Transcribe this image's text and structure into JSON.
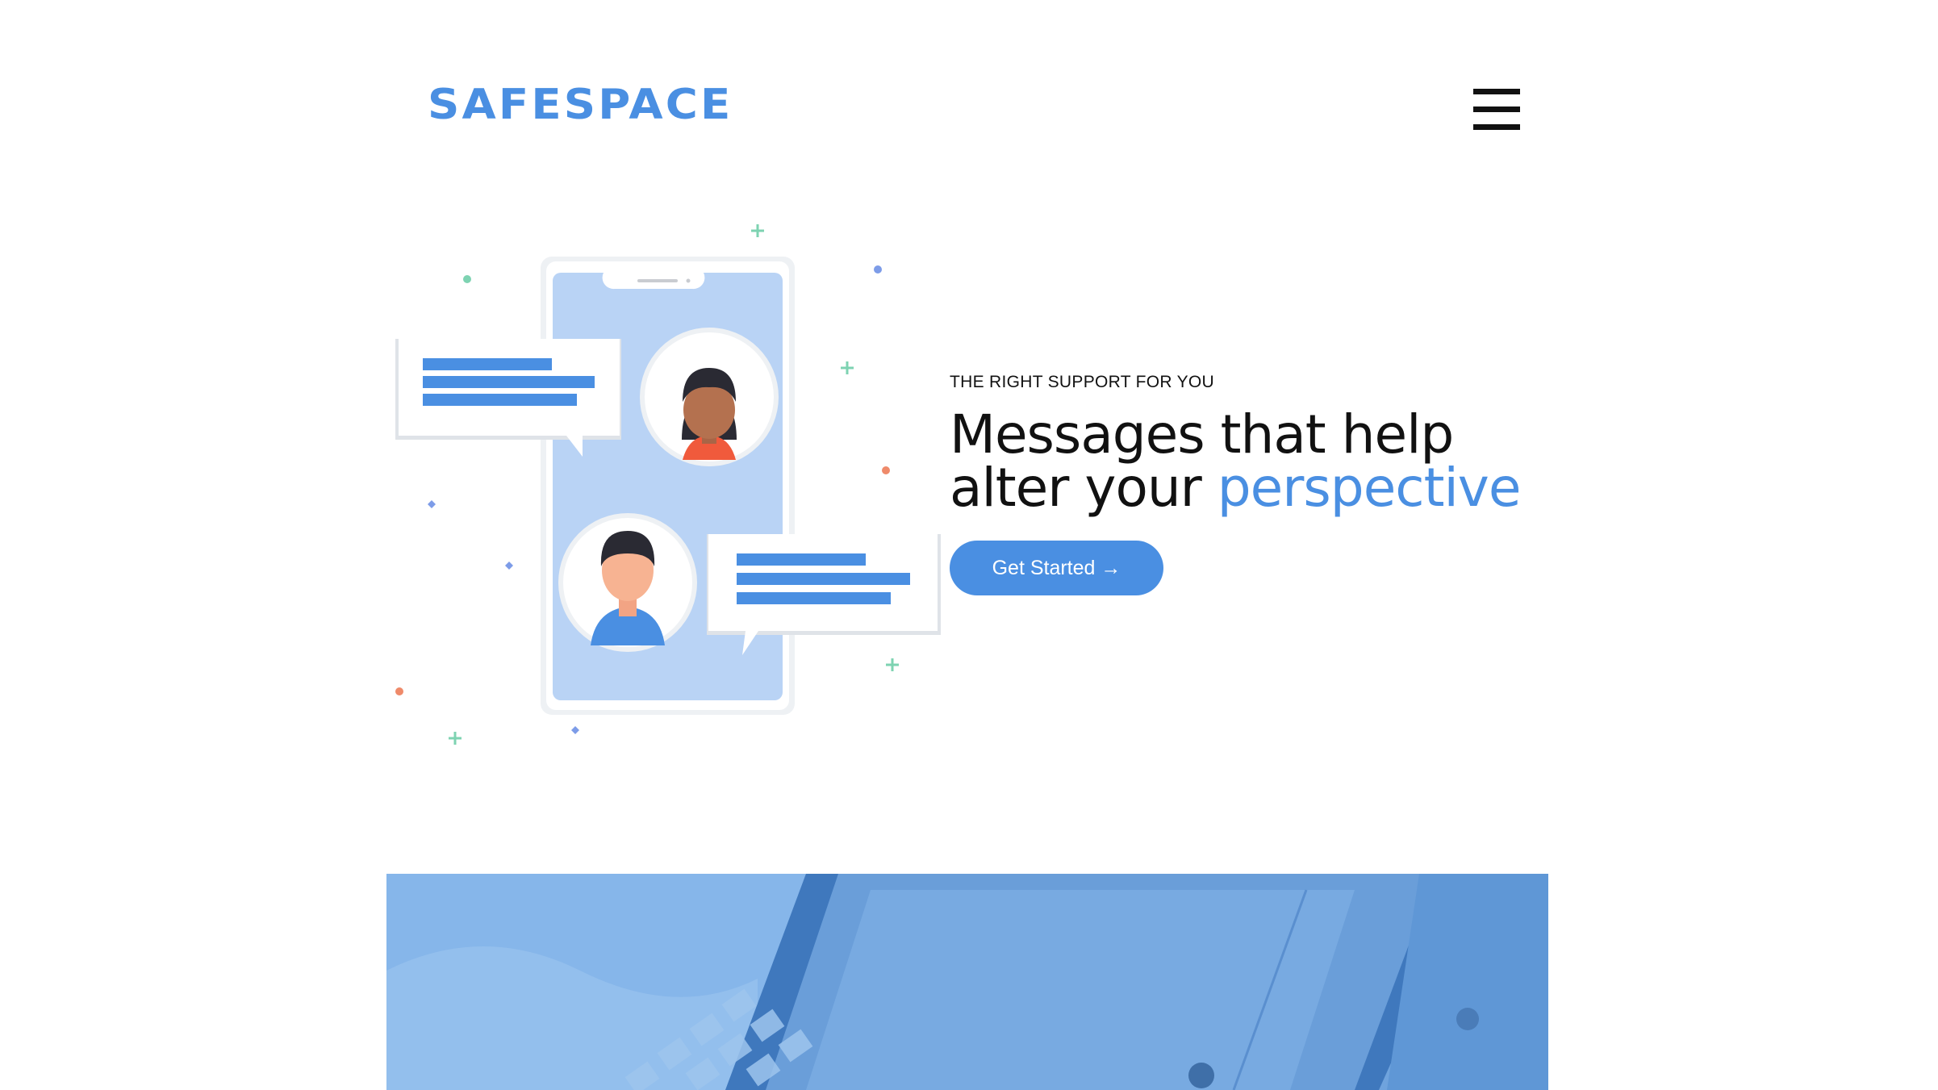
{
  "header": {
    "logo_text": "SAFESPACE",
    "menu_icon": "hamburger-menu-icon"
  },
  "hero": {
    "eyebrow": "THE RIGHT SUPPORT FOR YOU",
    "headline_line1": "Messages that help",
    "headline_line2_prefix": "alter your",
    "headline_accent": "perspective",
    "cta_label": "Get Started →"
  },
  "colors": {
    "brand": "#4a8fe2",
    "text": "#111111",
    "phone_screen": "#b9d3f5",
    "banner_overlay": "#4a8fe2"
  }
}
